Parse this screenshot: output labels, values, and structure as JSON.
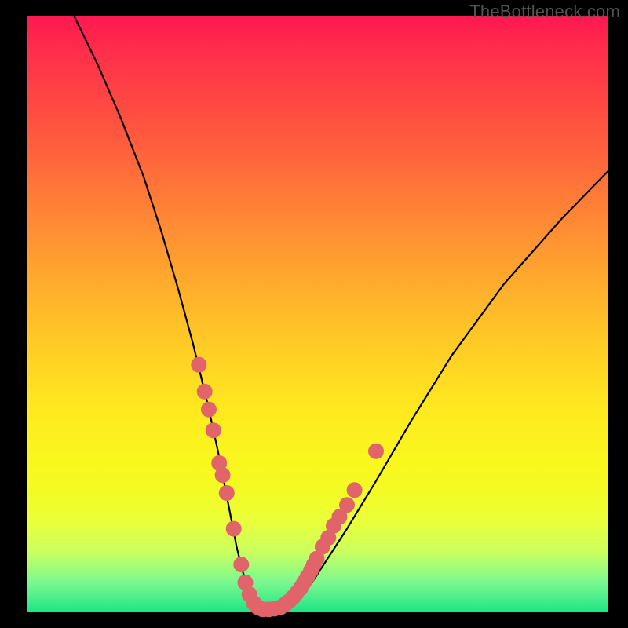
{
  "watermark": "TheBottleneck.com",
  "chart_data": {
    "type": "line",
    "title": "",
    "xlabel": "",
    "ylabel": "",
    "xlim": [
      0,
      100
    ],
    "ylim": [
      0,
      100
    ],
    "series": [
      {
        "name": "curve",
        "x": [
          8,
          12,
          16,
          20,
          23,
          26,
          28.5,
          31,
          32.8,
          34,
          35,
          36,
          37,
          38,
          38.8,
          39.5,
          40.2,
          41,
          43,
          45,
          47,
          49,
          51,
          55,
          60,
          66,
          73,
          82,
          92,
          100
        ],
        "y": [
          100,
          92,
          83,
          73,
          64,
          54,
          45,
          35,
          27,
          21,
          16,
          11,
          7,
          4,
          2,
          1,
          0.5,
          0.5,
          0.5,
          1.5,
          3,
          5,
          8,
          14,
          22,
          32,
          43,
          55,
          66,
          74
        ]
      }
    ],
    "markers": [
      {
        "name": "dot",
        "x": 29.5,
        "y": 41.5
      },
      {
        "name": "dot",
        "x": 30.5,
        "y": 37
      },
      {
        "name": "dot",
        "x": 31.2,
        "y": 34
      },
      {
        "name": "dot",
        "x": 32,
        "y": 30.5
      },
      {
        "name": "dot",
        "x": 33,
        "y": 25
      },
      {
        "name": "dot",
        "x": 33.6,
        "y": 23
      },
      {
        "name": "dot",
        "x": 34.3,
        "y": 20
      },
      {
        "name": "dot",
        "x": 35.5,
        "y": 14
      },
      {
        "name": "dot",
        "x": 36.8,
        "y": 8
      },
      {
        "name": "dot",
        "x": 37.5,
        "y": 5
      },
      {
        "name": "dot",
        "x": 38.2,
        "y": 3
      },
      {
        "name": "dot",
        "x": 39,
        "y": 1.5
      },
      {
        "name": "dot",
        "x": 39.7,
        "y": 0.8
      },
      {
        "name": "dot",
        "x": 40.5,
        "y": 0.5
      },
      {
        "name": "dot",
        "x": 41.5,
        "y": 0.5
      },
      {
        "name": "dot",
        "x": 42.5,
        "y": 0.6
      },
      {
        "name": "dot",
        "x": 43.5,
        "y": 0.8
      },
      {
        "name": "dot",
        "x": 44.3,
        "y": 1.3
      },
      {
        "name": "dot",
        "x": 45,
        "y": 1.8
      },
      {
        "name": "dot",
        "x": 45.7,
        "y": 2.5
      },
      {
        "name": "dot",
        "x": 46.3,
        "y": 3.2
      },
      {
        "name": "dot",
        "x": 47,
        "y": 4
      },
      {
        "name": "dot",
        "x": 47.6,
        "y": 5
      },
      {
        "name": "dot",
        "x": 48.2,
        "y": 6
      },
      {
        "name": "dot",
        "x": 48.8,
        "y": 7
      },
      {
        "name": "dot",
        "x": 49.3,
        "y": 8
      },
      {
        "name": "dot",
        "x": 49.8,
        "y": 9
      },
      {
        "name": "dot",
        "x": 50.8,
        "y": 11
      },
      {
        "name": "dot",
        "x": 51.8,
        "y": 12.5
      },
      {
        "name": "dot",
        "x": 52.7,
        "y": 14.5
      },
      {
        "name": "dot",
        "x": 53.7,
        "y": 16
      },
      {
        "name": "dot",
        "x": 55,
        "y": 18.0
      },
      {
        "name": "dot",
        "x": 56.3,
        "y": 20.5
      },
      {
        "name": "dot",
        "x": 60.0,
        "y": 27.0
      }
    ],
    "colors": {
      "curve": "#000000",
      "marker": "#e0646a"
    }
  }
}
